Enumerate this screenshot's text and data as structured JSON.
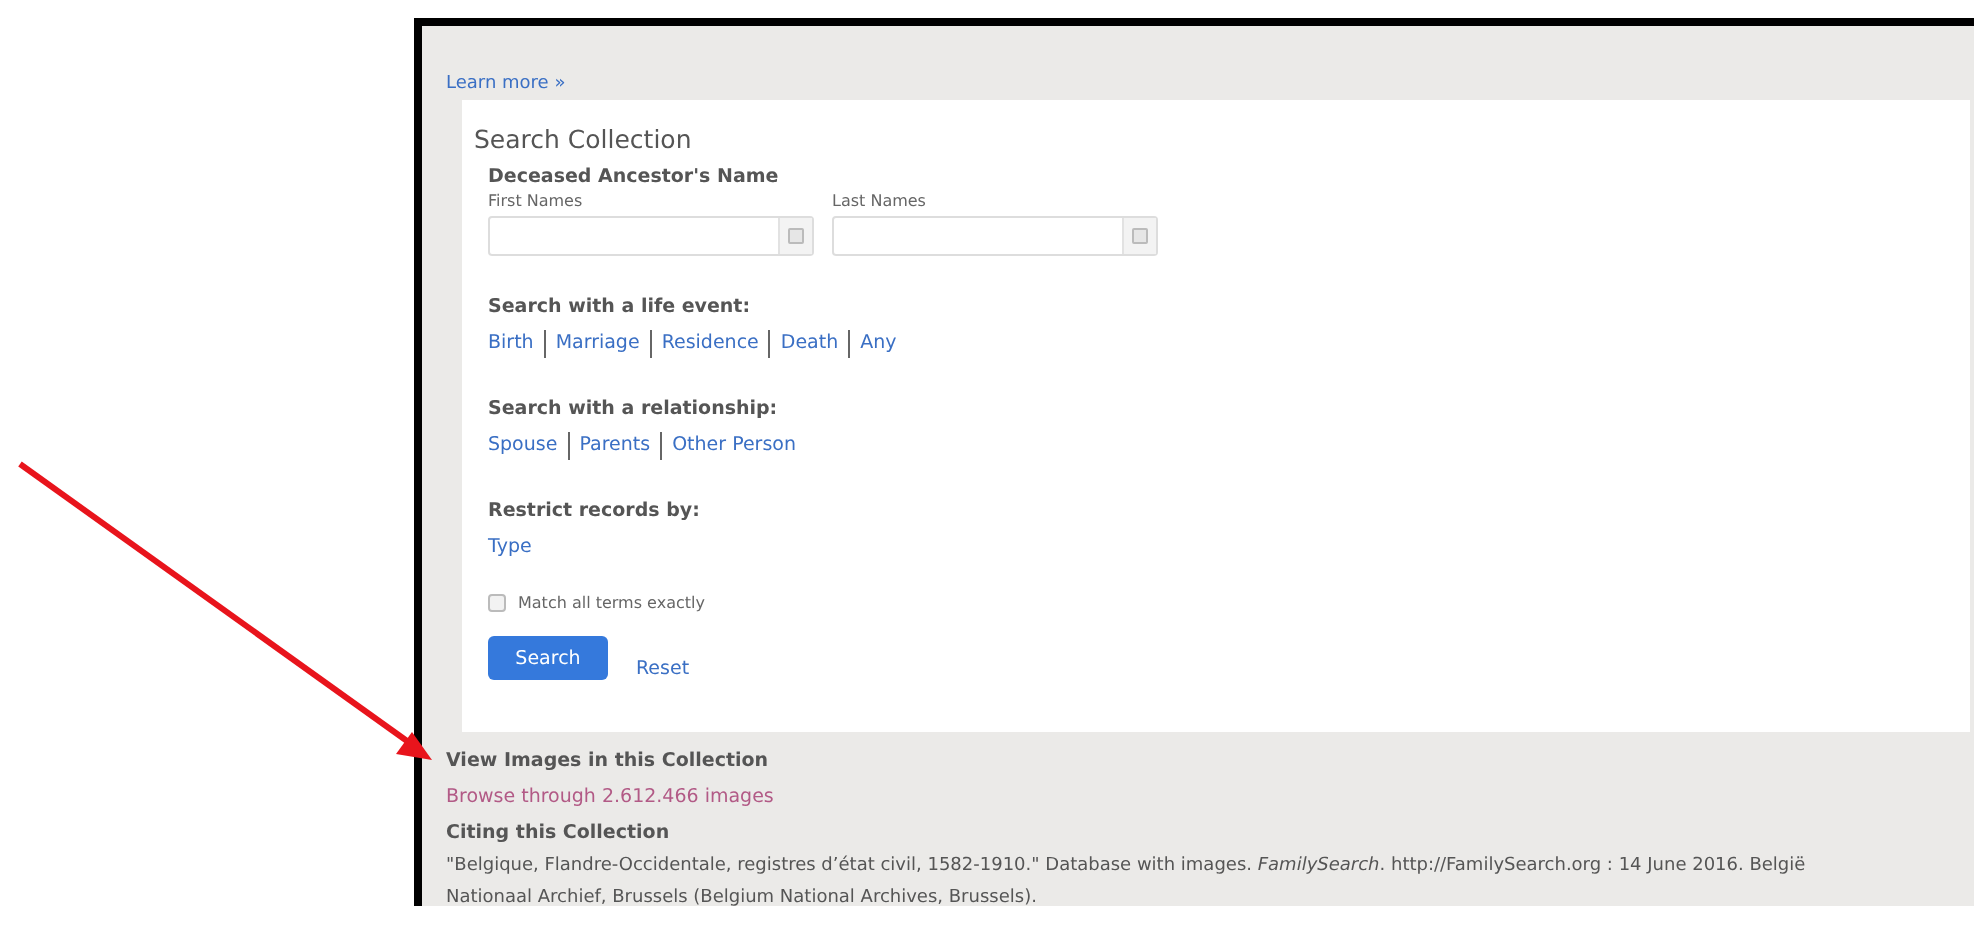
{
  "learn_more": "Learn more »",
  "search": {
    "title": "Search Collection",
    "name_heading": "Deceased Ancestor's Name",
    "fields": [
      {
        "label": "First Names"
      },
      {
        "label": "Last Names"
      }
    ],
    "sections": [
      {
        "heading": "Search with a life event:",
        "links": [
          "Birth",
          "Marriage",
          "Residence",
          "Death",
          "Any"
        ]
      },
      {
        "heading": "Search with a relationship:",
        "links": [
          "Spouse",
          "Parents",
          "Other Person"
        ]
      },
      {
        "heading": "Restrict records by:",
        "links": [
          "Type"
        ]
      }
    ],
    "match_exact": {
      "label": "Match all terms exactly",
      "checked": false
    },
    "search_button": "Search",
    "reset": "Reset"
  },
  "images": {
    "heading": "View Images in this Collection",
    "link": "Browse through 2.612.466 images"
  },
  "citing": {
    "heading": "Citing this Collection",
    "text": "\"Belgique, Flandre-Occidentale, registres d’état civil, 1582-1910.\" Database with images. *FamilySearch*. http://FamilySearch.org : 14 June 2016. België Nationaal Archief, Brussels (Belgium National Archives, Brussels)."
  }
}
